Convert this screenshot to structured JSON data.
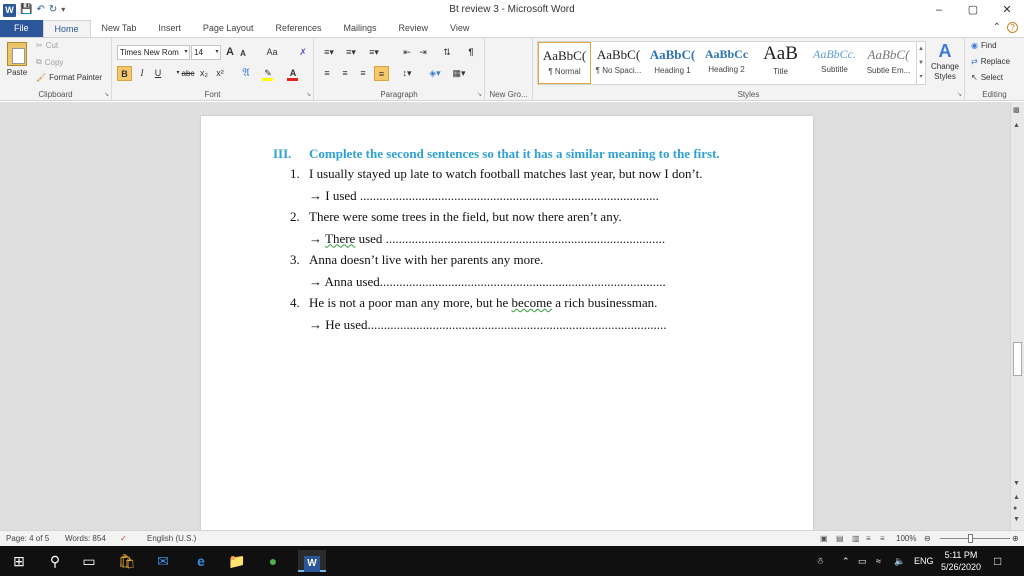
{
  "window": {
    "title": "Bt review 3  -  Microsoft Word",
    "controls": [
      "–",
      "▢",
      "✕"
    ]
  },
  "tabs": [
    "File",
    "Home",
    "New Tab",
    "Insert",
    "Page Layout",
    "References",
    "Mailings",
    "Review",
    "View"
  ],
  "ribbon": {
    "clipboard": {
      "paste": "Paste",
      "cut": "Cut",
      "copy": "Copy",
      "format_painter": "Format Painter",
      "label": "Clipboard"
    },
    "font": {
      "family": "Times New Rom",
      "size": "14",
      "grow": "A",
      "shrink": "A",
      "case": "Aa",
      "bold": "B",
      "italic": "I",
      "underline": "U",
      "strike": "abc",
      "subscript": "x₂",
      "superscript": "x²",
      "label": "Font",
      "highlight_color": "#ffff00",
      "font_color": "#e2231a"
    },
    "paragraph": {
      "label": "Paragraph",
      "pilcrow": "¶"
    },
    "new_group": {
      "label": "New Gro..."
    },
    "styles": {
      "label": "Styles",
      "items": [
        {
          "sample": "AaBbC(",
          "name": "¶ Normal"
        },
        {
          "sample": "AaBbC(",
          "name": "¶ No Spaci..."
        },
        {
          "sample": "AaBbC(",
          "name": "Heading 1"
        },
        {
          "sample": "AaBbCc",
          "name": "Heading 2"
        },
        {
          "sample": "AaB",
          "name": "Title"
        },
        {
          "sample": "AaBbCc.",
          "name": "Subtitle"
        },
        {
          "sample": "AaBbC(",
          "name": "Subtle Em..."
        }
      ],
      "change_styles": "Change Styles"
    },
    "editing": {
      "label": "Editing",
      "find": "Find",
      "replace": "Replace",
      "select": "Select"
    }
  },
  "document": {
    "heading_num": "III.",
    "heading_text": "Complete the second sentences so that it has a similar meaning to the first.",
    "items": [
      {
        "n": "1.",
        "text": "I usually stayed up late to watch football matches last year, but now I don’t.",
        "answer": "→ I used ............................................................................................"
      },
      {
        "n": "2.",
        "text": "There were some trees in the field, but now there aren’t any.",
        "answer": "→ There used ......................................................................................"
      },
      {
        "n": "3.",
        "text": "Anna doesn’t live with her parents any more.",
        "answer": "→ Anna used........................................................................................"
      },
      {
        "n": "4.",
        "text": "He is not a poor man any more, but he become a rich businessman.",
        "answer": "→ He used............................................................................................"
      }
    ]
  },
  "statusbar": {
    "page": "Page: 4 of 5",
    "words": "Words: 854",
    "language": "English (U.S.)",
    "zoom": "100%",
    "zoom_fraction": 0.5
  },
  "taskbar": {
    "time": "5:11 PM",
    "date": "5/26/2020",
    "lang": "ENG"
  }
}
